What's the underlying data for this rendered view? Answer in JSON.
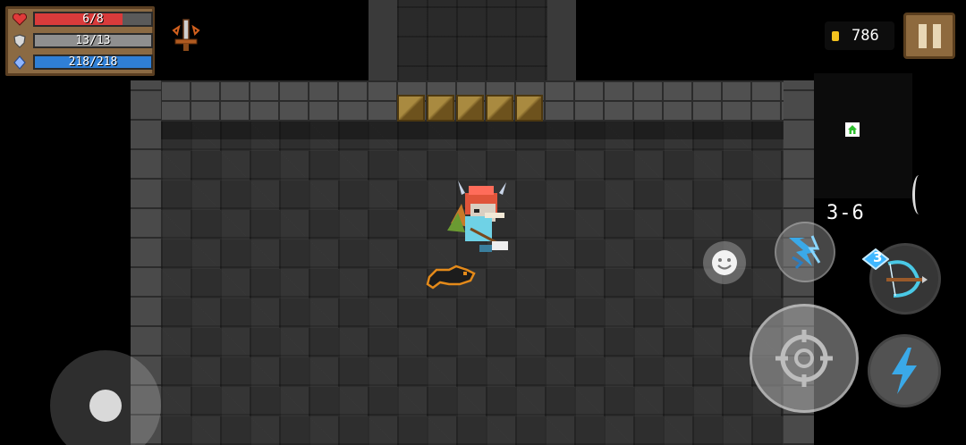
{
  "hud": {
    "hp": {
      "label": "6/8",
      "current": 6,
      "max": 8,
      "color": "#d93b3b"
    },
    "armor": {
      "label": "13/13",
      "current": 13,
      "max": 13,
      "color": "#8f8f8f"
    },
    "energy": {
      "label": "218/218",
      "current": 218,
      "max": 218,
      "color": "#2f7fd6"
    },
    "buff_icon": "sword-buff-icon"
  },
  "coins": {
    "value": "786",
    "icon": "gold-coin-icon",
    "color": "#f3c21f"
  },
  "pause": {
    "icon": "pause-icon"
  },
  "minimap": {
    "home_icon": "home-icon",
    "home_color": "#2fbf2f"
  },
  "level": {
    "label": "3-6"
  },
  "weapon": {
    "ammo_cost": "3",
    "icon": "crossbow-icon"
  },
  "controls": {
    "joystick": "movement-joystick",
    "emote_icon": "smiley-face-icon",
    "skill_icon": "lightning-burst-icon",
    "attack_icon": "crosshair-icon",
    "dash_icon": "lightning-bolt-icon"
  },
  "colors": {
    "panel": "#8b6a43",
    "floor": "#2e2e2e",
    "wall": "#4b4b4b",
    "door": "#8a6a2c",
    "skill_accent": "#3aa9e8"
  }
}
